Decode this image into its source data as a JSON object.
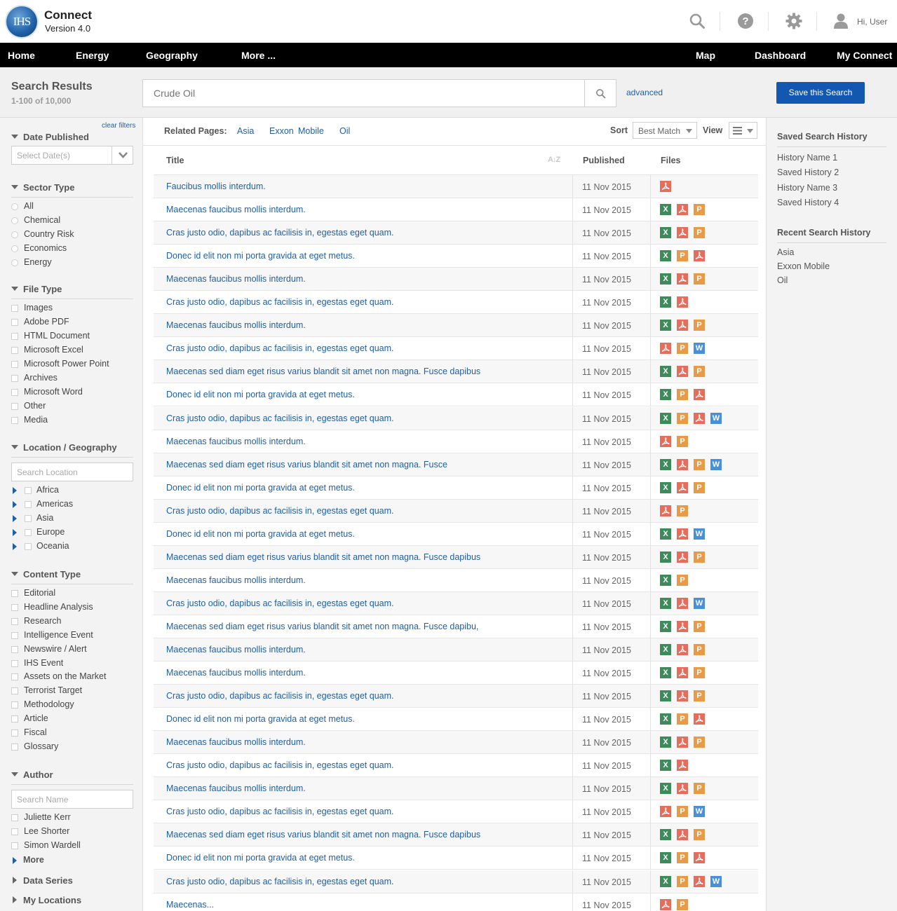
{
  "header": {
    "logo_text": "IHS",
    "app_name": "Connect",
    "app_version": "Version 4.0",
    "user_greeting": "Hi, User"
  },
  "nav": {
    "left": [
      "Home",
      "Energy",
      "Geography",
      "More ..."
    ],
    "right": [
      "Map",
      "Dashboard",
      "My Connect"
    ]
  },
  "search": {
    "title": "Search Results",
    "count": "1-100 of 10,000",
    "placeholder": "Crude Oil",
    "advanced": "advanced",
    "save_button": "Save this Search"
  },
  "filters": {
    "clear": "clear filters",
    "date": {
      "label": "Date Published",
      "placeholder": "Select Date(s)"
    },
    "sector": {
      "label": "Sector Type",
      "options": [
        "All",
        "Chemical",
        "Country Risk",
        "Economics",
        "Energy"
      ]
    },
    "file_type": {
      "label": "File Type",
      "options": [
        "Images",
        "Adobe PDF",
        "HTML Document",
        "Microsoft Excel",
        "Microsoft Power Point",
        "Archives",
        "Microsoft Word",
        "Other",
        "Media"
      ]
    },
    "location": {
      "label": "Location / Geography",
      "placeholder": "Search Location",
      "options": [
        "Africa",
        "Americas",
        "Asia",
        "Europe",
        "Oceania"
      ]
    },
    "content_type": {
      "label": "Content Type",
      "options": [
        "Editorial",
        "Headline Analysis",
        "Research",
        "Intelligence Event",
        "Newswire / Alert",
        "IHS Event",
        "Assets on the Market",
        "Terrorist Target",
        "Methodology",
        "Article",
        "Fiscal",
        "Glossary"
      ]
    },
    "author": {
      "label": "Author",
      "placeholder": "Search Name",
      "options": [
        "Juliette Kerr",
        "Lee Shorter",
        "Simon Wardell"
      ],
      "more": "More"
    },
    "data_series": "Data Series",
    "my_locations": "My Locations"
  },
  "related": {
    "label": "Related Pages:",
    "links": [
      "Asia",
      "Exxon",
      "Mobile",
      "Oil"
    ]
  },
  "sort": {
    "label": "Sort",
    "value": "Best Match"
  },
  "view": {
    "label": "View"
  },
  "table": {
    "headers": {
      "title": "Title",
      "published": "Published",
      "files": "Files"
    },
    "rows": [
      {
        "title": "Faucibus mollis interdum.",
        "date": "11 Nov 2015",
        "files": [
          "pdf"
        ]
      },
      {
        "title": "Maecenas faucibus mollis interdum.",
        "date": "11 Nov 2015",
        "files": [
          "x",
          "pdf",
          "p"
        ]
      },
      {
        "title": "Cras justo odio, dapibus ac facilisis in, egestas eget quam.",
        "date": "11 Nov 2015",
        "files": [
          "x",
          "pdf",
          "p"
        ]
      },
      {
        "title": "Donec id elit non mi porta gravida at eget metus.",
        "date": "11 Nov 2015",
        "files": [
          "x",
          "p",
          "pdf"
        ]
      },
      {
        "title": "Maecenas faucibus mollis interdum.",
        "date": "11 Nov 2015",
        "files": [
          "x",
          "pdf",
          "p"
        ]
      },
      {
        "title": "Cras justo odio, dapibus ac facilisis in, egestas eget quam.",
        "date": "11 Nov 2015",
        "files": [
          "x",
          "pdf"
        ]
      },
      {
        "title": "Maecenas faucibus mollis interdum.",
        "date": "11 Nov 2015",
        "files": [
          "x",
          "pdf",
          "p"
        ]
      },
      {
        "title": "Cras justo odio, dapibus ac facilisis in, egestas eget quam.",
        "date": "11 Nov 2015",
        "files": [
          "pdf",
          "p",
          "w"
        ]
      },
      {
        "title": "Maecenas sed diam eget risus varius blandit sit amet non magna. Fusce dapibus",
        "date": "11 Nov 2015",
        "files": [
          "x",
          "pdf",
          "p"
        ]
      },
      {
        "title": "Donec id elit non mi porta gravida at eget metus.",
        "date": "11 Nov 2015",
        "files": [
          "x",
          "p",
          "pdf"
        ]
      },
      {
        "title": "Cras justo odio, dapibus ac facilisis in, egestas eget quam.",
        "date": "11 Nov 2015",
        "files": [
          "x",
          "p",
          "pdf",
          "w"
        ]
      },
      {
        "title": "Maecenas faucibus mollis interdum.",
        "date": "11 Nov 2015",
        "files": [
          "pdf",
          "p"
        ]
      },
      {
        "title": "Maecenas sed diam eget risus varius blandit sit amet non magna. Fusce",
        "date": "11 Nov 2015",
        "files": [
          "x",
          "pdf",
          "p",
          "w"
        ]
      },
      {
        "title": "Donec id elit non mi porta gravida at eget metus.",
        "date": "11 Nov 2015",
        "files": [
          "x",
          "pdf",
          "p"
        ]
      },
      {
        "title": "Cras justo odio, dapibus ac facilisis in, egestas eget quam.",
        "date": "11 Nov 2015",
        "files": [
          "pdf",
          "p"
        ]
      },
      {
        "title": "Donec id elit non mi porta gravida at eget metus.",
        "date": "11 Nov 2015",
        "files": [
          "x",
          "pdf",
          "w"
        ]
      },
      {
        "title": "Maecenas sed diam eget risus varius blandit sit amet non magna. Fusce dapibus",
        "date": "11 Nov 2015",
        "files": [
          "x",
          "pdf",
          "p"
        ]
      },
      {
        "title": "Maecenas faucibus mollis interdum.",
        "date": "11 Nov 2015",
        "files": [
          "x",
          "p"
        ]
      },
      {
        "title": "Cras justo odio, dapibus ac facilisis in, egestas eget quam.",
        "date": "11 Nov 2015",
        "files": [
          "x",
          "pdf",
          "w"
        ]
      },
      {
        "title": "Maecenas sed diam eget risus varius blandit sit amet non magna. Fusce dapibu,",
        "date": "11 Nov 2015",
        "files": [
          "x",
          "pdf",
          "p"
        ]
      },
      {
        "title": "Maecenas faucibus mollis interdum.",
        "date": "11 Nov 2015",
        "files": [
          "x",
          "pdf",
          "p"
        ]
      },
      {
        "title": "Maecenas faucibus mollis interdum.",
        "date": "11 Nov 2015",
        "files": [
          "x",
          "pdf",
          "p"
        ]
      },
      {
        "title": "Cras justo odio, dapibus ac facilisis in, egestas eget quam.",
        "date": "11 Nov 2015",
        "files": [
          "x",
          "pdf",
          "p"
        ]
      },
      {
        "title": "Donec id elit non mi porta gravida at eget metus.",
        "date": "11 Nov 2015",
        "files": [
          "x",
          "p",
          "pdf"
        ]
      },
      {
        "title": "Maecenas faucibus mollis interdum.",
        "date": "11 Nov 2015",
        "files": [
          "x",
          "pdf",
          "p"
        ]
      },
      {
        "title": "Cras justo odio, dapibus ac facilisis in, egestas eget quam.",
        "date": "11 Nov 2015",
        "files": [
          "x",
          "pdf"
        ]
      },
      {
        "title": "Maecenas faucibus mollis interdum.",
        "date": "11 Nov 2015",
        "files": [
          "x",
          "pdf",
          "p"
        ]
      },
      {
        "title": "Cras justo odio, dapibus ac facilisis in, egestas eget quam.",
        "date": "11 Nov 2015",
        "files": [
          "pdf",
          "p",
          "w"
        ]
      },
      {
        "title": "Maecenas sed diam eget risus varius blandit sit amet non magna. Fusce dapibus",
        "date": "11 Nov 2015",
        "files": [
          "x",
          "pdf",
          "p"
        ]
      },
      {
        "title": "Donec id elit non mi porta gravida at eget metus.",
        "date": "11 Nov 2015",
        "files": [
          "x",
          "p",
          "pdf"
        ]
      },
      {
        "title": "Cras justo odio, dapibus ac facilisis in, egestas eget quam.",
        "date": "11 Nov 2015",
        "files": [
          "x",
          "p",
          "pdf",
          "w"
        ]
      },
      {
        "title": "Maecenas...",
        "date": "11 Nov 2015",
        "files": [
          "pdf",
          "p"
        ]
      }
    ]
  },
  "saved_history": {
    "label": "Saved Search History",
    "items": [
      "History Name 1",
      "Saved History 2",
      "History Name 3",
      "Saved History 4"
    ]
  },
  "recent_history": {
    "label": "Recent Search History",
    "items": [
      "Asia",
      "Exxon Mobile",
      "Oil"
    ]
  },
  "icons": {
    "header": [
      "search-icon",
      "help-icon",
      "gear-icon",
      "user-icon"
    ],
    "file_types": {
      "x": "excel-file-icon",
      "p": "powerpoint-file-icon",
      "w": "word-file-icon",
      "pdf": "pdf-file-icon"
    }
  },
  "colors": {
    "nav_bg": "#000000",
    "primary_button": "#1257b0",
    "link": "#1f5fa6",
    "excel": "#3d8b5b",
    "powerpoint": "#e89a47",
    "word": "#4a90d9",
    "pdf": "#e66c5b"
  }
}
